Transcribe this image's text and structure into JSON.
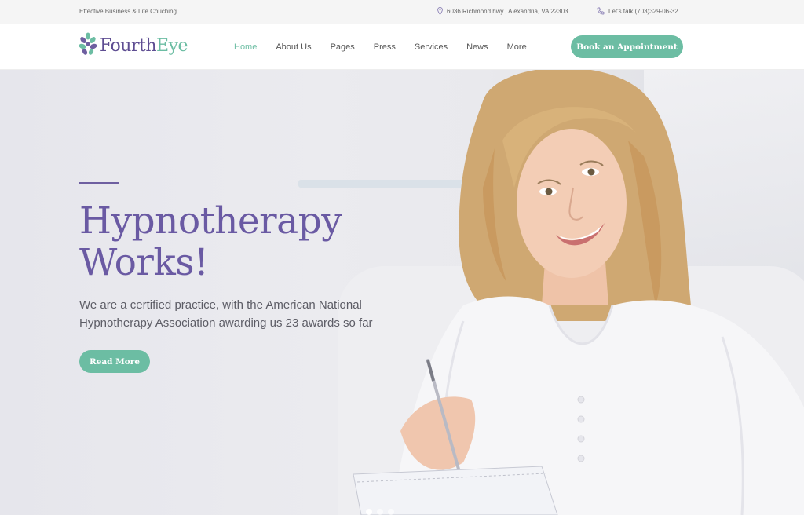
{
  "topbar": {
    "tagline": "Effective Business & Life Couching",
    "address": "6036 Richmond hwy., Alexandria, VA 22303",
    "phone": "Let's talk (703)329-06-32",
    "icons": {
      "address": "map-pin-icon",
      "phone": "phone-icon"
    }
  },
  "header": {
    "logo": {
      "part1": "Fourth",
      "part2": "Eye"
    },
    "nav": [
      {
        "label": "Home",
        "active": true
      },
      {
        "label": "About Us",
        "active": false
      },
      {
        "label": "Pages",
        "active": false
      },
      {
        "label": "Press",
        "active": false
      },
      {
        "label": "Services",
        "active": false
      },
      {
        "label": "News",
        "active": false
      },
      {
        "label": "More",
        "active": false
      }
    ],
    "cta_label": "Book an Appointment"
  },
  "hero": {
    "title_line1": "Hypnotherapy",
    "title_line2": "Works!",
    "subtitle_line1": "We are a certified practice, with the American National",
    "subtitle_line2": "Hypnotherapy Association awarding us 23 awards so far",
    "button_label": "Read More",
    "slides": 3,
    "active_slide": 0
  },
  "colors": {
    "brand_purple": "#6a5aa3",
    "brand_green": "#6cbda3",
    "topbar_bg": "#f5f5f5"
  }
}
